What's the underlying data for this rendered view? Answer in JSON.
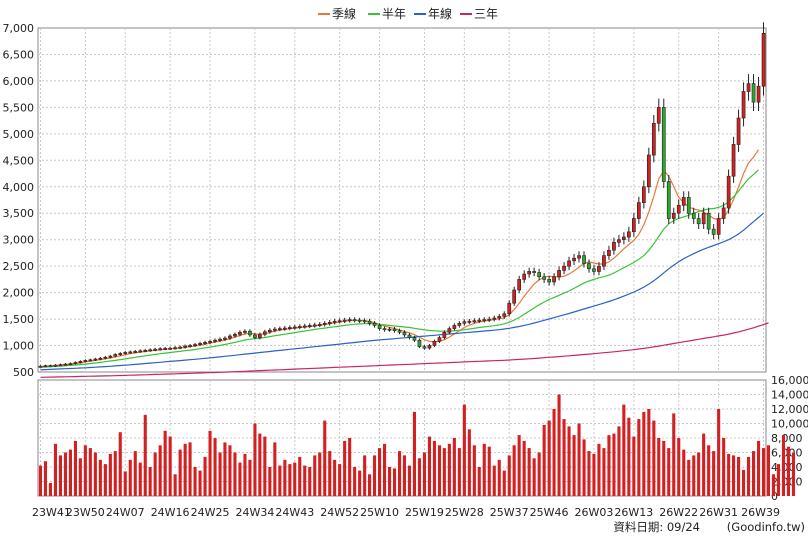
{
  "legend": [
    {
      "name": "季線",
      "color": "#e8783a"
    },
    {
      "name": "半年",
      "color": "#38c438"
    },
    {
      "name": "年線",
      "color": "#2a62c8"
    },
    {
      "name": "三年",
      "color": "#c8266a"
    }
  ],
  "footer": {
    "date_label": "資料日期: 09/24",
    "source": "(Goodinfo.tw)"
  },
  "colors": {
    "up": "#d42020",
    "down": "#2aa82a",
    "volume": "#d42020",
    "grid": "#c8c8c8"
  },
  "chart_data": [
    {
      "type": "candlestick",
      "title": "",
      "xlabel": "",
      "ylabel": "",
      "ylim": [
        500,
        7000
      ],
      "yticks": [
        500,
        1000,
        1500,
        2000,
        2500,
        3000,
        3500,
        4000,
        4500,
        5000,
        5500,
        6000,
        6500,
        7000
      ],
      "ytick_labels": [
        "500",
        "1,000",
        "1,500",
        "2,000",
        "2,500",
        "3,000",
        "3,500",
        "4,000",
        "4,500",
        "5,000",
        "5,500",
        "6,000",
        "6,500",
        "7,000"
      ],
      "x_tick_labels": [
        "23W41",
        "23W50",
        "24W07",
        "24W16",
        "24W25",
        "24W34",
        "24W43",
        "24W52",
        "25W10",
        "25W19",
        "25W28",
        "25W37",
        "25W46",
        "26W03",
        "26W13",
        "26W22",
        "26W31",
        "26W39"
      ],
      "grid": true,
      "weekly_close": [
        610,
        620,
        615,
        630,
        640,
        650,
        660,
        680,
        700,
        720,
        730,
        745,
        760,
        780,
        800,
        830,
        850,
        870,
        880,
        890,
        900,
        910,
        920,
        930,
        940,
        945,
        950,
        960,
        970,
        990,
        1000,
        1020,
        1040,
        1060,
        1080,
        1100,
        1120,
        1140,
        1180,
        1210,
        1250,
        1270,
        1200,
        1150,
        1210,
        1260,
        1290,
        1310,
        1320,
        1330,
        1340,
        1350,
        1360,
        1370,
        1380,
        1390,
        1400,
        1420,
        1440,
        1460,
        1470,
        1480,
        1490,
        1480,
        1470,
        1460,
        1420,
        1380,
        1320,
        1300,
        1310,
        1280,
        1250,
        1200,
        1150,
        1100,
        980,
        950,
        1000,
        1080,
        1150,
        1250,
        1320,
        1380,
        1420,
        1450,
        1460,
        1470,
        1480,
        1490,
        1500,
        1520,
        1550,
        1600,
        1800,
        2050,
        2250,
        2350,
        2400,
        2380,
        2300,
        2250,
        2200,
        2300,
        2420,
        2500,
        2600,
        2650,
        2700,
        2550,
        2450,
        2400,
        2500,
        2700,
        2800,
        2950,
        3000,
        3050,
        3150,
        3400,
        3700,
        4000,
        4600,
        5200,
        5500,
        4100,
        3400,
        3500,
        3650,
        3800,
        3500,
        3400,
        3300,
        3500,
        3200,
        3100,
        3400,
        3600,
        4200,
        4800,
        5300,
        5800,
        5950,
        5600,
        5900,
        6900
      ],
      "weekly_open": [
        600,
        610,
        620,
        615,
        630,
        640,
        650,
        660,
        680,
        700,
        720,
        730,
        745,
        760,
        780,
        800,
        830,
        850,
        870,
        880,
        890,
        900,
        910,
        920,
        930,
        940,
        945,
        950,
        960,
        970,
        990,
        1000,
        1020,
        1040,
        1060,
        1080,
        1100,
        1120,
        1140,
        1180,
        1210,
        1250,
        1270,
        1200,
        1150,
        1210,
        1260,
        1290,
        1310,
        1320,
        1330,
        1340,
        1350,
        1360,
        1370,
        1380,
        1390,
        1400,
        1420,
        1440,
        1460,
        1470,
        1480,
        1490,
        1480,
        1470,
        1460,
        1420,
        1380,
        1320,
        1300,
        1310,
        1280,
        1250,
        1200,
        1150,
        1100,
        980,
        950,
        1000,
        1080,
        1150,
        1250,
        1320,
        1380,
        1420,
        1450,
        1460,
        1470,
        1480,
        1490,
        1500,
        1520,
        1550,
        1600,
        1800,
        2050,
        2250,
        2350,
        2400,
        2380,
        2300,
        2250,
        2200,
        2300,
        2420,
        2500,
        2600,
        2650,
        2700,
        2550,
        2450,
        2400,
        2500,
        2700,
        2800,
        2950,
        3000,
        3050,
        3150,
        3400,
        3700,
        4000,
        4600,
        5200,
        5500,
        4100,
        3400,
        3500,
        3650,
        3800,
        3500,
        3400,
        3300,
        3500,
        3200,
        3100,
        3400,
        3600,
        4200,
        4800,
        5300,
        5800,
        5950,
        5600,
        5900
      ],
      "series": [
        {
          "name": "季線",
          "values": [
            600,
            610,
            615,
            620,
            630,
            640,
            650,
            660,
            670,
            690,
            705,
            720,
            735,
            750,
            765,
            785,
            805,
            825,
            845,
            860,
            875,
            888,
            900,
            910,
            920,
            930,
            938,
            946,
            955,
            965,
            978,
            992,
            1008,
            1025,
            1045,
            1065,
            1085,
            1105,
            1130,
            1160,
            1190,
            1220,
            1230,
            1220,
            1215,
            1225,
            1245,
            1270,
            1290,
            1305,
            1318,
            1330,
            1340,
            1350,
            1360,
            1372,
            1385,
            1398,
            1412,
            1428,
            1445,
            1460,
            1472,
            1478,
            1476,
            1470,
            1455,
            1432,
            1400,
            1370,
            1345,
            1320,
            1295,
            1268,
            1240,
            1205,
            1160,
            1110,
            1080,
            1070,
            1080,
            1110,
            1160,
            1220,
            1280,
            1340,
            1385,
            1420,
            1445,
            1462,
            1476,
            1490,
            1505,
            1525,
            1580,
            1680,
            1800,
            1930,
            2050,
            2160,
            2240,
            2290,
            2310,
            2300,
            2295,
            2310,
            2350,
            2410,
            2480,
            2550,
            2580,
            2560,
            2540,
            2540,
            2580,
            2650,
            2740,
            2830,
            2910,
            2990,
            3100,
            3280,
            3520,
            3820,
            4150,
            4300,
            4200,
            4000,
            3800,
            3700,
            3620,
            3580,
            3560,
            3520,
            3460,
            3400,
            3380,
            3420,
            3560,
            3760,
            4000,
            4250,
            4450,
            4560,
            4700
          ]
        },
        {
          "name": "半年",
          "values": [
            590,
            595,
            600,
            605,
            610,
            618,
            625,
            632,
            640,
            650,
            660,
            670,
            682,
            694,
            707,
            720,
            734,
            748,
            763,
            778,
            792,
            806,
            820,
            833,
            845,
            857,
            868,
            879,
            890,
            902,
            914,
            926,
            940,
            955,
            970,
            986,
            1002,
            1020,
            1040,
            1060,
            1082,
            1104,
            1120,
            1130,
            1140,
            1152,
            1168,
            1185,
            1200,
            1215,
            1230,
            1245,
            1260,
            1275,
            1290,
            1305,
            1318,
            1330,
            1342,
            1355,
            1368,
            1380,
            1392,
            1402,
            1408,
            1412,
            1412,
            1408,
            1400,
            1390,
            1380,
            1370,
            1360,
            1350,
            1340,
            1325,
            1310,
            1295,
            1285,
            1278,
            1272,
            1270,
            1272,
            1278,
            1288,
            1300,
            1312,
            1325,
            1340,
            1352,
            1364,
            1375,
            1390,
            1410,
            1440,
            1480,
            1530,
            1590,
            1650,
            1710,
            1770,
            1820,
            1870,
            1910,
            1950,
            1990,
            2030,
            2080,
            2130,
            2180,
            2220,
            2250,
            2280,
            2300,
            2330,
            2370,
            2420,
            2470,
            2520,
            2570,
            2630,
            2700,
            2800,
            2920,
            3060,
            3200,
            3300,
            3360,
            3400,
            3430,
            3460,
            3500,
            3530,
            3560,
            3580,
            3590,
            3610,
            3650,
            3720,
            3810,
            3920,
            4040,
            4150,
            4230,
            4320
          ]
        },
        {
          "name": "年線",
          "values": [
            540,
            545,
            550,
            554,
            558,
            562,
            566,
            570,
            575,
            580,
            585,
            590,
            596,
            602,
            608,
            615,
            622,
            629,
            636,
            644,
            652,
            660,
            668,
            676,
            684,
            692,
            700,
            708,
            716,
            724,
            732,
            740,
            749,
            758,
            767,
            776,
            786,
            796,
            806,
            816,
            827,
            838,
            848,
            858,
            868,
            878,
            888,
            898,
            908,
            918,
            928,
            938,
            948,
            958,
            968,
            978,
            988,
            998,
            1008,
            1018,
            1028,
            1038,
            1048,
            1058,
            1068,
            1078,
            1088,
            1098,
            1106,
            1114,
            1122,
            1130,
            1138,
            1146,
            1154,
            1162,
            1170,
            1178,
            1186,
            1194,
            1202,
            1210,
            1218,
            1226,
            1234,
            1242,
            1250,
            1258,
            1266,
            1274,
            1282,
            1290,
            1300,
            1312,
            1326,
            1342,
            1360,
            1380,
            1402,
            1426,
            1450,
            1476,
            1502,
            1528,
            1554,
            1580,
            1606,
            1634,
            1662,
            1690,
            1718,
            1746,
            1774,
            1802,
            1832,
            1864,
            1898,
            1934,
            1972,
            2012,
            2056,
            2104,
            2160,
            2224,
            2296,
            2374,
            2450,
            2520,
            2584,
            2640,
            2690,
            2736,
            2780,
            2820,
            2856,
            2890,
            2924,
            2960,
            3000,
            3050,
            3110,
            3180,
            3260,
            3340,
            3420,
            3500
          ]
        },
        {
          "name": "三年",
          "values": [
            400,
            402,
            404,
            406,
            408,
            410,
            412,
            414,
            416,
            418,
            420,
            422,
            424,
            426,
            428,
            430,
            433,
            436,
            439,
            442,
            445,
            448,
            451,
            454,
            457,
            460,
            463,
            466,
            469,
            472,
            475,
            478,
            481,
            484,
            487,
            490,
            494,
            498,
            502,
            506,
            510,
            514,
            518,
            522,
            526,
            530,
            534,
            538,
            542,
            546,
            550,
            554,
            558,
            562,
            566,
            570,
            574,
            578,
            582,
            586,
            590,
            594,
            598,
            602,
            606,
            610,
            614,
            618,
            622,
            626,
            630,
            634,
            638,
            642,
            646,
            650,
            654,
            658,
            662,
            666,
            670,
            674,
            678,
            682,
            686,
            690,
            694,
            698,
            702,
            706,
            710,
            714,
            718,
            722,
            727,
            732,
            738,
            744,
            750,
            756,
            763,
            770,
            777,
            784,
            791,
            798,
            806,
            814,
            822,
            830,
            838,
            846,
            855,
            864,
            873,
            882,
            892,
            902,
            912,
            922,
            934,
            946,
            960,
            975,
            990,
            1006,
            1022,
            1038,
            1054,
            1070,
            1086,
            1102,
            1118,
            1134,
            1150,
            1166,
            1182,
            1198,
            1216,
            1236,
            1258,
            1282,
            1308,
            1336,
            1366,
            1396,
            1426
          ]
        }
      ]
    },
    {
      "type": "bar",
      "title": "",
      "ylim": [
        0,
        16000
      ],
      "yticks": [
        0,
        2000,
        4000,
        6000,
        8000,
        10000,
        12000,
        14000,
        16000
      ],
      "ytick_labels": [
        "0",
        "2,000",
        "4,000",
        "6,000",
        "8,000",
        "10,000",
        "12,000",
        "14,000",
        "16,000"
      ],
      "series": [
        {
          "name": "",
          "values": [
            4200,
            4800,
            1800,
            7200,
            5600,
            6000,
            6400,
            7600,
            5200,
            7000,
            6600,
            6000,
            5000,
            4400,
            5800,
            6200,
            8800,
            3400,
            5000,
            6200,
            4600,
            11200,
            4000,
            6000,
            7000,
            9000,
            8200,
            3000,
            6400,
            7200,
            7400,
            4000,
            3500,
            5400,
            9000,
            8000,
            6000,
            7400,
            7000,
            6000,
            4600,
            5800,
            5000,
            10000,
            8600,
            8200,
            4000,
            7400,
            4200,
            5000,
            4400,
            4600,
            5400,
            4200,
            4000,
            5600,
            6000,
            10400,
            6200,
            5000,
            4400,
            7600,
            8000,
            4000,
            3500,
            5600,
            3000,
            5600,
            6600,
            7200,
            4000,
            3800,
            6200,
            5600,
            4200,
            11600,
            5200,
            6000,
            8200,
            7600,
            7000,
            6600,
            7200,
            8000,
            6600,
            12600,
            9200,
            7000,
            4000,
            7200,
            6800,
            4200,
            5000,
            3500,
            5600,
            7000,
            8400,
            7600,
            6600,
            5200,
            6000,
            9800,
            10400,
            12000,
            14000,
            10600,
            9600,
            8400,
            10000,
            7800,
            6200,
            5800,
            7200,
            6600,
            8400,
            8600,
            9600,
            12600,
            10800,
            8200,
            10600,
            11600,
            12000,
            10400,
            8000,
            7600,
            6600,
            11400,
            8000,
            6400,
            5000,
            5600,
            6000,
            8600,
            7000,
            6200,
            12000,
            8000,
            5800,
            5600,
            5400,
            3600,
            5400,
            6200,
            7600,
            6600,
            7000,
            3000,
            4400,
            8400,
            6800,
            6000
          ]
        }
      ]
    }
  ]
}
